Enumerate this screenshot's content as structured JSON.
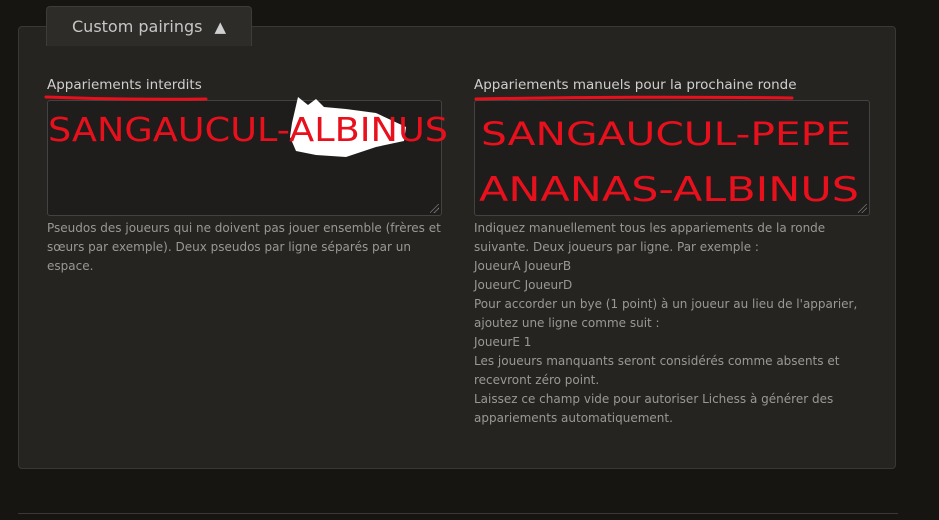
{
  "section": {
    "title": "Custom pairings",
    "toggle_icon": "▲"
  },
  "forbidden": {
    "label": "Appariements interdits",
    "value": "SANGAUCUL-ALBINUS",
    "help": "Pseudos des joueurs qui ne doivent pas jouer ensemble (frères et sœurs par exemple). Deux pseudos par ligne séparés par un espace."
  },
  "manual": {
    "label": "Appariements manuels pour la prochaine ronde",
    "value_lines": [
      "SANGAUCUL-PEPE",
      "ANANAS-ALBINUS"
    ],
    "help_lines": [
      "Indiquez manuellement tous les appariements de la ronde",
      "suivante. Deux joueurs par ligne. Par exemple :",
      "JoueurA JoueurB",
      "JoueurC JoueurD",
      "Pour accorder un bye (1 point) à un joueur au lieu de l'apparier,",
      "ajoutez une ligne comme suit :",
      "JoueurE 1",
      "Les joueurs manquants seront considérés comme absents et",
      "recevront zéro point.",
      "Laissez ce champ vide pour autoriser Lichess à générer des",
      "appariements automatiquement."
    ]
  },
  "colors": {
    "background": "#161512",
    "panel": "#262421",
    "annotation_red": "#e8101c"
  }
}
